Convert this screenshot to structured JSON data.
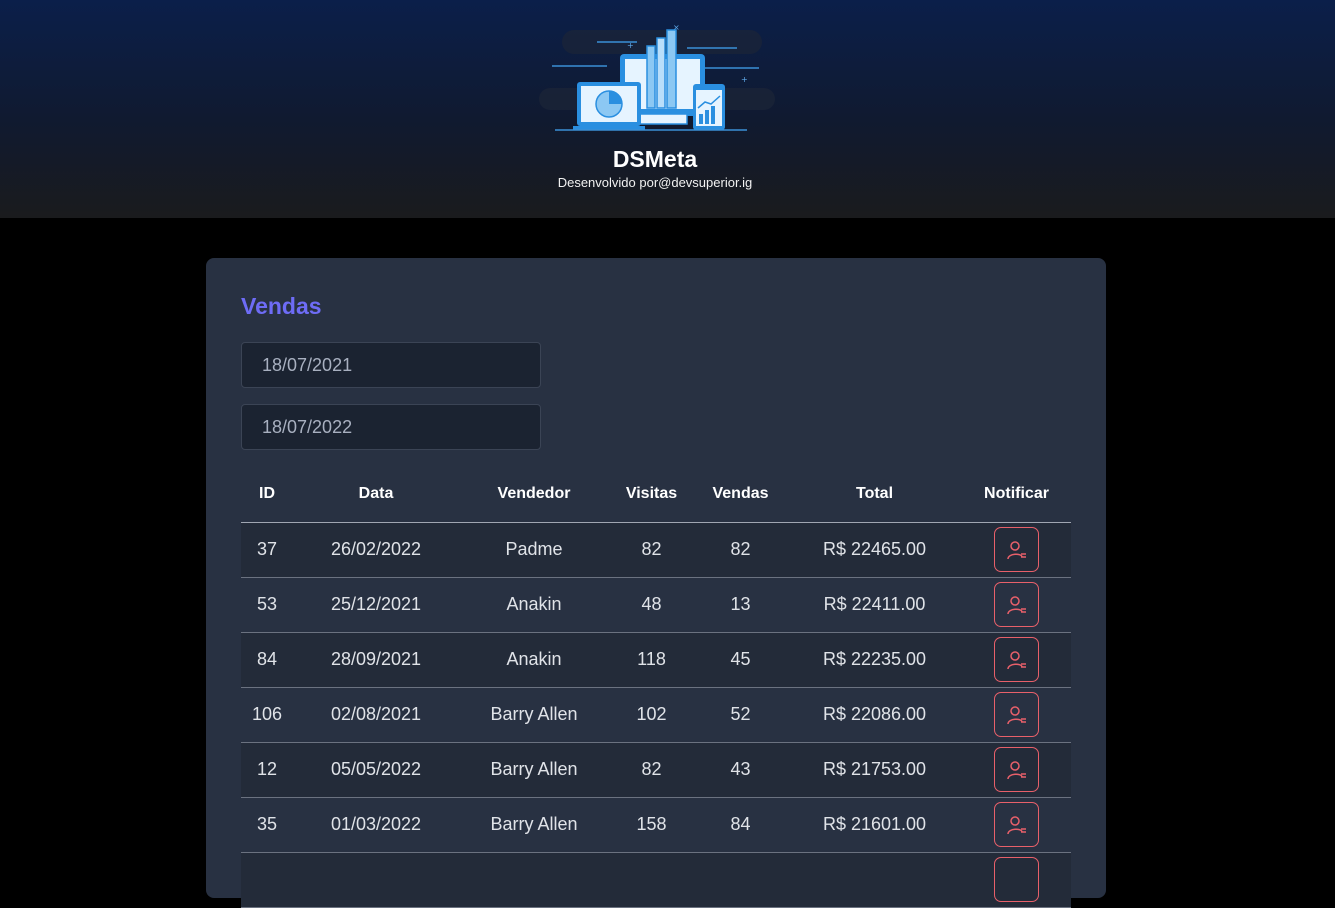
{
  "header": {
    "app_name": "DSMeta",
    "credit": "Desenvolvido por@devsuperior.ig"
  },
  "sales": {
    "title": "Vendas",
    "date_min": "18/07/2021",
    "date_max": "18/07/2022",
    "columns": [
      "ID",
      "Data",
      "Vendedor",
      "Visitas",
      "Vendas",
      "Total",
      "Notificar"
    ],
    "rows": [
      {
        "id": "37",
        "date": "26/02/2022",
        "seller": "Padme",
        "visits": "82",
        "deals": "82",
        "total": "R$ 22465.00"
      },
      {
        "id": "53",
        "date": "25/12/2021",
        "seller": "Anakin",
        "visits": "48",
        "deals": "13",
        "total": "R$ 22411.00"
      },
      {
        "id": "84",
        "date": "28/09/2021",
        "seller": "Anakin",
        "visits": "118",
        "deals": "45",
        "total": "R$ 22235.00"
      },
      {
        "id": "106",
        "date": "02/08/2021",
        "seller": "Barry Allen",
        "visits": "102",
        "deals": "52",
        "total": "R$ 22086.00"
      },
      {
        "id": "12",
        "date": "05/05/2022",
        "seller": "Barry Allen",
        "visits": "82",
        "deals": "43",
        "total": "R$ 21753.00"
      },
      {
        "id": "35",
        "date": "01/03/2022",
        "seller": "Barry Allen",
        "visits": "158",
        "deals": "84",
        "total": "R$ 21601.00"
      }
    ],
    "notify_icon": "user-notify-icon"
  },
  "colors": {
    "accent": "#6e6cf6",
    "card_bg": "#283142",
    "notify_red": "#e8606a"
  }
}
